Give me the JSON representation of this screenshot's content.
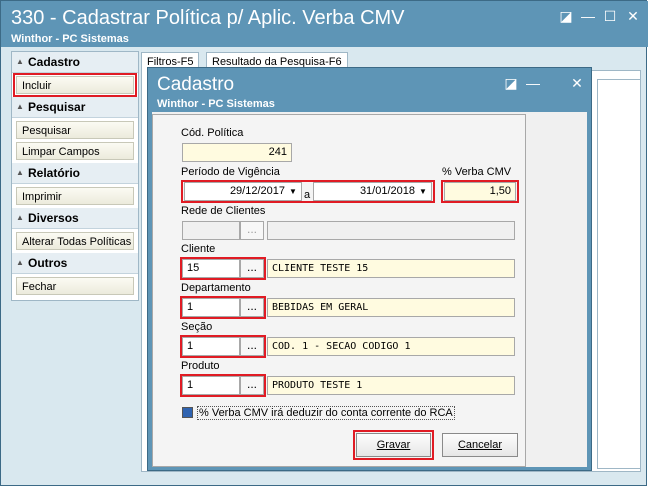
{
  "window": {
    "title": "330 - Cadastrar Política p/ Aplic. Verba CMV",
    "subtitle": "Winthor - PC Sistemas",
    "controls": {
      "restore": "◪",
      "minimize": "—",
      "maximize": "☐",
      "close": "✕"
    }
  },
  "sidebar": {
    "sections": [
      {
        "title": "Cadastro",
        "items": [
          "Incluir"
        ]
      },
      {
        "title": "Pesquisar",
        "items": [
          "Pesquisar",
          "Limpar Campos"
        ]
      },
      {
        "title": "Relatório",
        "items": [
          "Imprimir"
        ]
      },
      {
        "title": "Diversos",
        "items": [
          "Alterar Todas Políticas"
        ]
      },
      {
        "title": "Outros",
        "items": [
          "Fechar"
        ]
      }
    ]
  },
  "tabs": [
    "Filtros-F5",
    "Resultado da Pesquisa-F6"
  ],
  "dialog": {
    "title": "Cadastro",
    "subtitle": "Winthor - PC Sistemas",
    "controls": {
      "restore": "◪",
      "minimize": "—",
      "close": "✕"
    },
    "fields": {
      "cod_politica_label": "Cód. Política",
      "cod_politica_value": "241",
      "periodo_label": "Período de Vigência",
      "periodo_inicio": "29/12/2017",
      "periodo_sep": "a",
      "periodo_fim": "31/01/2018",
      "verba_label": "% Verba CMV",
      "verba_value": "1,50",
      "rede_label": "Rede de Clientes",
      "rede_code": "",
      "rede_desc": "",
      "cliente_label": "Cliente",
      "cliente_code": "15",
      "cliente_desc": "CLIENTE TESTE 15",
      "departamento_label": "Departamento",
      "departamento_code": "1",
      "departamento_desc": "BEBIDAS EM GERAL",
      "secao_label": "Seção",
      "secao_code": "1",
      "secao_desc": "COD. 1 - SECAO CODIGO 1",
      "produto_label": "Produto",
      "produto_code": "1",
      "produto_desc": "PRODUTO TESTE 1",
      "ellipsis": "..."
    },
    "checkbox_label": "% Verba CMV irá deduzir do conta corrente do RCA",
    "checkbox_checked": true,
    "gravar_label": "Gravar",
    "cancelar_label": "Cancelar"
  },
  "colors": {
    "titlebar": "#5e95b6",
    "highlight": "#e01b24",
    "field_bg": "#fffbe0"
  }
}
